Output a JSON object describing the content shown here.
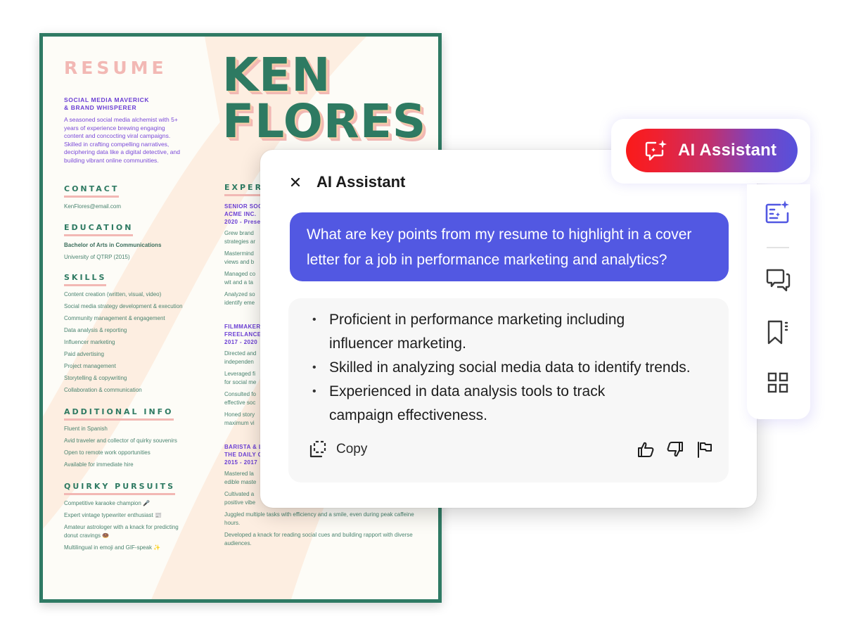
{
  "resume": {
    "title": "RESUME",
    "name_line1": "KEN",
    "name_line2": "FLORES",
    "tagline_line1": "SOCIAL MEDIA MAVERICK",
    "tagline_line2": "& BRAND WHISPERER",
    "summary": "A seasoned social media alchemist with 5+ years of experience brewing engaging content and concocting viral campaigns. Skilled in crafting compelling narratives, deciphering data like a digital detective, and building vibrant online communities.",
    "contact": {
      "heading": "CONTACT",
      "email": "KenFlores@email.com"
    },
    "education": {
      "heading": "EDUCATION",
      "degree": "Bachelor of Arts in Communications",
      "school": "University of QTRP (2015)"
    },
    "skills": {
      "heading": "SKILLS",
      "items": [
        "Content creation (written, visual, video)",
        "Social media strategy development & execution",
        "Community management & engagement",
        "Data analysis & reporting",
        "Influencer marketing",
        "Paid advertising",
        "Project management",
        "Storytelling & copywriting",
        "Collaboration & communication"
      ]
    },
    "additional_info": {
      "heading": "ADDITIONAL INFO",
      "items": [
        "Fluent in Spanish",
        "Avid traveler and collector of quirky souvenirs",
        "Open to remote work opportunities",
        "Available for immediate hire"
      ]
    },
    "quirky_pursuits": {
      "heading": "QUIRKY PURSUITS",
      "items": [
        "Competitive karaoke champion 🎤",
        "Expert vintage typewriter enthusiast 📰",
        "Amateur astrologer with a knack for predicting donut cravings 🍩",
        "Multilingual in emoji and GIF-speak ✨"
      ]
    },
    "experience": {
      "heading": "EXPER",
      "jobs": [
        {
          "title_line1": "SENIOR SOC",
          "title_line2": "ACME INC.",
          "dates": "2020 - Prese",
          "bullets": [
            "Grew brand\nstrategies ar",
            "Mastermind\nviews and b",
            "Managed co\nwit and a ta",
            "Analyzed so\nidentify eme"
          ]
        },
        {
          "title_line1": "FILMMAKER",
          "title_line2": "FREELANCE",
          "dates": "2017 - 2020",
          "bullets": [
            "Directed and\nindependen",
            "Leveraged fi\nfor social me",
            "Consulted fo\neffective soc",
            "Honed story\nmaximum vi"
          ]
        },
        {
          "title_line1": "BARISTA & L",
          "title_line2": "THE DAILY C",
          "dates": "2015 - 2017",
          "bullets": [
            "Mastered la\nedible maste",
            "Cultivated a\npositive vibe",
            "Juggled multiple tasks with efficiency and a smile, even during peak caffeine hours.",
            "Developed a knack for reading social cues and building rapport with diverse audiences."
          ]
        }
      ]
    }
  },
  "assistant_panel": {
    "title": "AI Assistant",
    "close_icon": "close-icon",
    "user_message": "What are key points from my resume to highlight in a cover letter for a job in performance marketing and analytics?",
    "response": {
      "bullets": [
        [
          "Proficient in performance marketing including",
          "influencer marketing."
        ],
        [
          "Skilled in analyzing social media data to identify trends."
        ],
        [
          "Experienced in data analysis tools to track",
          "campaign effectiveness."
        ]
      ],
      "copy_label": "Copy",
      "feedback_icons": [
        "thumbs-up-icon",
        "thumbs-down-icon",
        "flag-icon"
      ]
    }
  },
  "toolbar": {
    "ai_button_label": "AI Assistant",
    "ai_button_icon": "ai-chat-sparkle-icon",
    "rail_icons": [
      "generative-summary-icon",
      "comments-icon",
      "bookmarks-icon",
      "grid-icon"
    ]
  },
  "colors": {
    "resume_green": "#2f7a64",
    "resume_pink": "#f2b8b4",
    "resume_purple": "#6b3fd4",
    "user_bubble": "#5258e2",
    "gradient_start": "#fa1a1a",
    "gradient_end": "#5651dc",
    "rail_active_icon": "#5258e2"
  }
}
